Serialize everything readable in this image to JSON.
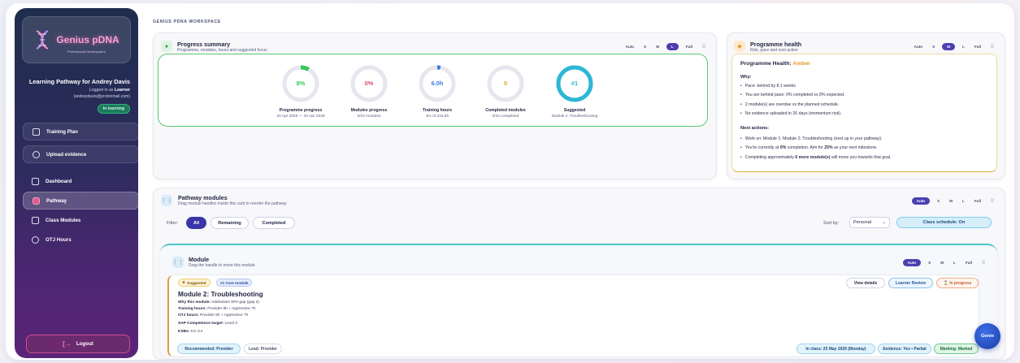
{
  "brand": {
    "name": "Genius pDNA",
    "tagline": "Professional Development"
  },
  "sidebar": {
    "pathway_title": "Learning Pathway for Andrey Davis",
    "logged_in_prefix": "Logged in as",
    "role": "Learner",
    "email": "(andreydavis@protonmail.com)",
    "status_pill": "In learning",
    "items": [
      {
        "label": "Training Plan"
      },
      {
        "label": "Upload evidence"
      },
      {
        "label": "Dashboard"
      },
      {
        "label": "Pathway"
      },
      {
        "label": "Class Modules"
      },
      {
        "label": "OTJ Hours"
      }
    ],
    "logout": "Logout"
  },
  "workspace_title": "GENIUS PDNA WORKSPACE",
  "progress": {
    "title": "Progress summary",
    "subtitle": "Programme, modules, hours and suggested focus",
    "sizes": [
      "Auto",
      "S",
      "M",
      "L",
      "Full"
    ],
    "selected_size": "L",
    "stats": [
      {
        "value": "8%",
        "label": "Programme progress",
        "sub": "20 Apr 2026 — 20 Apr 2028",
        "fill": 0.08,
        "color": "#34c759"
      },
      {
        "value": "0%",
        "label": "Modules progress",
        "sub": "0/24 modules",
        "fill": 0,
        "color": "#e0447a"
      },
      {
        "value": "6.0h",
        "label": "Training hours",
        "sub": "3% of 215.5h",
        "fill": 0.03,
        "color": "#3a78e0"
      },
      {
        "value": "0",
        "label": "Completed modules",
        "sub": "0/24 completed",
        "fill": 0,
        "color": "#e5a21e"
      },
      {
        "value": "#1",
        "label": "Suggested",
        "sub": "Module 2: Troubleshooting",
        "fill": 1,
        "color": "#2cb7d6"
      }
    ]
  },
  "health": {
    "title": "Programme health",
    "subtitle": "Risk, pace and next action",
    "sizes": [
      "Auto",
      "S",
      "M",
      "L",
      "Full"
    ],
    "selected_size": "M",
    "heading_prefix": "Programme Health:",
    "heading_status": "Amber",
    "why_label": "Why:",
    "why": [
      "Pace: behind by 8.1 weeks",
      "You are behind pace: 0% completed vs 8% expected.",
      "2 module(s) are overdue vs the planned schedule.",
      "No evidence uploaded in 26 days (momentum risk)."
    ],
    "next_label": "Next actions:",
    "next_1": "Work on: Module 1: Module 2: Troubleshooting (next up in your pathway).",
    "next_2a": "You're currently at ",
    "next_2b": "0%",
    "next_2c": " completion. Aim for ",
    "next_2d": "25%",
    "next_2e": " as your next milestone.",
    "next_3a": "Completing approximately ",
    "next_3b": "6 more module(s)",
    "next_3c": " will move you towards that goal."
  },
  "pathway": {
    "title": "Pathway modules",
    "subtitle": "Drag module handles inside this card to reorder the pathway",
    "sizes": [
      "Auto",
      "S",
      "M",
      "L",
      "Full"
    ],
    "selected_size": "Auto",
    "filter_label": "Filter:",
    "filters": [
      "All",
      "Remaining",
      "Completed"
    ],
    "sort_label": "Sort by:",
    "sort_value": "Personal",
    "schedule_label": "Class schedule: On"
  },
  "module": {
    "title": "Module",
    "subtitle": "Drag the handle to move this module",
    "sizes": [
      "Auto",
      "S",
      "M",
      "L",
      "Full"
    ],
    "selected_size": "Auto",
    "badge_suggested": "Suggested",
    "badge_core": "#1 Core module",
    "name": "Module 2: Troubleshooting",
    "why_label": "Why this module:",
    "why_value": "Addresses SPA gap (gap 2)",
    "training_label": "Training hours:",
    "training_value": "Provider 8h + Apprentice 7h",
    "otj_label": "OTJ hours:",
    "otj_value": "Provider 8h + Apprentice 7h",
    "sap_label": "SAP Competence target:",
    "sap_value": "Level 3",
    "ksb_label": "KSBs:",
    "ksb_value": "K3, K4",
    "view_details": "View details",
    "learner_review": "Learner Review",
    "in_progress": "In progress",
    "recommended": "Recommended: Provider",
    "lead": "Lead: Provider",
    "in_class": "In class: 25 May 2026 (Monday)",
    "evidence": "Evidence: Yes • Partial",
    "marking": "Marking: Marked"
  },
  "genie": "Genie"
}
